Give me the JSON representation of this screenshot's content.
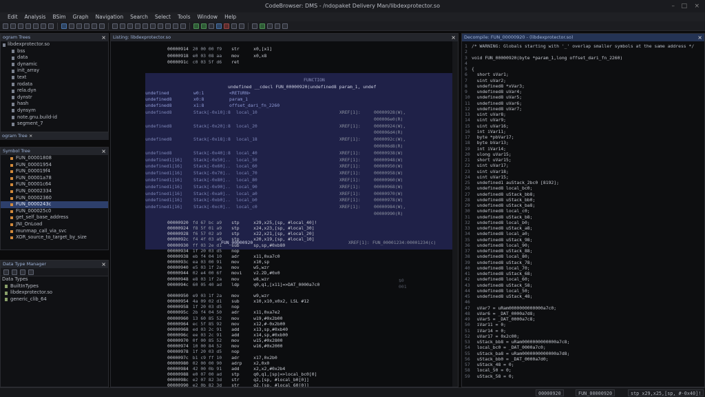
{
  "window": {
    "title": "CodeBrowser: DMS - /ndopaket Delivery Man/libdexprotector.so",
    "controls": [
      "–",
      "□",
      "×"
    ]
  },
  "menu": [
    "Edit",
    "Analysis",
    "BSim",
    "Graph",
    "Navigation",
    "Search",
    "Select",
    "Tools",
    "Window",
    "Help"
  ],
  "program_trees": {
    "header": "ogram Trees",
    "items": [
      "libdexprotector.so",
      "bss",
      "data",
      "dynamic",
      "init_array",
      "text",
      "rodata",
      "rela.dyn",
      "dynstr",
      "hash",
      "dynsym",
      "note.gnu.build-id",
      "segment_7"
    ],
    "tab": "ogram Tree"
  },
  "symbol_tree": {
    "header": "Symbol Tree",
    "items": [
      "FUN_00001808",
      "FUN_00001954",
      "FUN_000019f4",
      "FUN_00001a78",
      "FUN_00001c64",
      "FUN_00002334",
      "FUN_00002360",
      "FUN_0000243c",
      "FUN_000025c0",
      "get_self_base_address",
      "JNI_OnLoad",
      "munmap_call_via_svc",
      "XOR_source_to_target_by_size"
    ],
    "selected_index": 7
  },
  "data_type_manager": {
    "header": "Data Type Manager",
    "section": "Data Types",
    "items": [
      "BuiltInTypes",
      "libdexprotector.so",
      "generic_clib_64"
    ]
  },
  "listing": {
    "header": "Listing: libdexprotector.so",
    "top_rows": [
      {
        "addr": "00000914",
        "bytes": "20 00 00 f9",
        "mn": "str",
        "op": "x0,[x1]"
      },
      {
        "addr": "00000918",
        "bytes": "e0 03 08 aa",
        "mn": "mov",
        "op": "x0,x8"
      },
      {
        "addr": "0000091c",
        "bytes": "c0 03 5f d6",
        "mn": "ret",
        "op": ""
      }
    ],
    "func_label": "FUNCTION",
    "signature": "undefined __cdecl FUN_00000920(undefined8 param_1, undef",
    "params": [
      {
        "t": "undefined",
        "loc": "w0:1",
        "name": "<RETURN>"
      },
      {
        "t": "undefined8",
        "loc": "x0:8",
        "name": "param_1"
      },
      {
        "t": "undefined8",
        "loc": "x1:8",
        "name": "offset_dari_fn_2260"
      }
    ],
    "locals": [
      {
        "t": "undefined8",
        "loc": "Stack[-0x10]:8",
        "name": "local_10",
        "xref": "XREF[1]:",
        "ref": "00000928(W),"
      },
      {
        "t": "",
        "loc": "",
        "name": "",
        "xref": "",
        "ref": "000006e0(R)"
      },
      {
        "t": "undefined8",
        "loc": "Stack[-0x20]:8",
        "name": "local_20",
        "xref": "XREF[1]:",
        "ref": "00000924(W),"
      },
      {
        "t": "",
        "loc": "",
        "name": "",
        "xref": "",
        "ref": "000006d4(R)"
      },
      {
        "t": "undefined8",
        "loc": "Stack[-0x18]:8",
        "name": "local_18",
        "xref": "XREF[1]:",
        "ref": "0000092c(W),"
      },
      {
        "t": "",
        "loc": "",
        "name": "",
        "xref": "",
        "ref": "000006d8(R)"
      },
      {
        "t": "undefined8",
        "loc": "Stack[-0x40]:8",
        "name": "local_40",
        "xref": "XREF[1]:",
        "ref": "00000938(W)"
      },
      {
        "t": "undefined1[16]",
        "loc": "Stack[-0x50]..",
        "name": "local_50",
        "xref": "XREF[1]:",
        "ref": "00000948(W)"
      },
      {
        "t": "undefined1[16]",
        "loc": "Stack[-0x60]..",
        "name": "local_60",
        "xref": "XREF[1]:",
        "ref": "00000950(W)"
      },
      {
        "t": "undefined1[16]",
        "loc": "Stack[-0x70]..",
        "name": "local_70",
        "xref": "XREF[1]:",
        "ref": "00000958(W)"
      },
      {
        "t": "undefined1[16]",
        "loc": "Stack[-0x80]..",
        "name": "local_80",
        "xref": "XREF[1]:",
        "ref": "00000960(W)"
      },
      {
        "t": "undefined1[16]",
        "loc": "Stack[-0x90]..",
        "name": "local_90",
        "xref": "XREF[1]:",
        "ref": "00000968(W)"
      },
      {
        "t": "undefined1[16]",
        "loc": "Stack[-0xa0]..",
        "name": "local_a0",
        "xref": "XREF[1]:",
        "ref": "00000970(W)"
      },
      {
        "t": "undefined1[16]",
        "loc": "Stack[-0xb0]..",
        "name": "local_b0",
        "xref": "XREF[1]:",
        "ref": "00000978(W)"
      },
      {
        "t": "undefined1[16]",
        "loc": "Stack[-0xc0]..",
        "name": "local_c0",
        "xref": "XREF[1]:",
        "ref": "00000984(W),"
      },
      {
        "t": "",
        "loc": "",
        "name": "",
        "xref": "",
        "ref": "00000990(R)"
      }
    ],
    "fn_footer": {
      "name": "FUN_00000920",
      "xref": "XREF[1]:",
      "ref": "FUN_00001234:00001234(c)"
    },
    "code_rows": [
      {
        "addr": "00000920",
        "bytes": "fd 67 bc a9",
        "mn": "stp",
        "op": "x29,x25,[sp, #local_40]!"
      },
      {
        "addr": "00000924",
        "bytes": "f8 5f 01 a9",
        "mn": "stp",
        "op": "x24,x23,[sp, #local_30]"
      },
      {
        "addr": "00000928",
        "bytes": "f6 57 02 a9",
        "mn": "stp",
        "op": "x22,x21,[sp, #local_20]"
      },
      {
        "addr": "0000092c",
        "bytes": "f4 4f 03 a9",
        "mn": "stp",
        "op": "x20,x19,[sp, #local_10]"
      },
      {
        "addr": "00000930",
        "bytes": "ff 03 2e d1",
        "mn": "sub",
        "op": "sp,sp,#0xb80"
      },
      {
        "addr": "00000934",
        "bytes": "1f 20 03 d5",
        "mn": "nop",
        "op": ""
      },
      {
        "addr": "00000938",
        "bytes": "eb f4 04 10",
        "mn": "adr",
        "op": "x11,0xa7c0"
      },
      {
        "addr": "0000093c",
        "bytes": "ea 03 00 91",
        "mn": "mov",
        "op": "x10,sp"
      },
      {
        "addr": "00000940",
        "bytes": "e5 03 1f 2a",
        "mn": "mov",
        "op": "w5,wzr"
      },
      {
        "addr": "00000944",
        "bytes": "02 e4 00 6f",
        "mn": "movi",
        "op": "v2.2D,#0x0"
      },
      {
        "addr": "00000948",
        "bytes": "e8 03 1f 2a",
        "mn": "mov",
        "op": "w8,wzr"
      },
      {
        "addr": "0000094c",
        "bytes": "60 05 40 ad",
        "mn": "ldp",
        "op": "q0,q1,[x11]=>DAT_0000a7c0"
      },
      {
        "addr": "",
        "bytes": "",
        "mn": "",
        "op": ""
      },
      {
        "addr": "00000950",
        "bytes": "e9 03 1f 2a",
        "mn": "mov",
        "op": "w9,wzr"
      },
      {
        "addr": "00000954",
        "bytes": "4a 09 02 d1",
        "mn": "sub",
        "op": "x10,x10,x0x2, LSL #12"
      },
      {
        "addr": "00000958",
        "bytes": "1f 20 03 d5",
        "mn": "nop",
        "op": ""
      },
      {
        "addr": "0000095c",
        "bytes": "2b f4 04 50",
        "mn": "adr",
        "op": "x11,0xa7e2"
      },
      {
        "addr": "00000960",
        "bytes": "13 60 85 52",
        "mn": "mov",
        "op": "w19,#0x2b00"
      },
      {
        "addr": "00000964",
        "bytes": "ec 5f 85 92",
        "mn": "mov",
        "op": "x12,#-0x2b00"
      },
      {
        "addr": "00000968",
        "bytes": "ed 03 2c 91",
        "mn": "add",
        "op": "x13,sp,#0xb40"
      },
      {
        "addr": "0000096c",
        "bytes": "ee 03 2c 91",
        "mn": "add",
        "op": "x14,sp,#0xb00"
      },
      {
        "addr": "00000970",
        "bytes": "0f 00 85 52",
        "mn": "mov",
        "op": "w15,#0x2800"
      },
      {
        "addr": "00000974",
        "bytes": "10 00 84 52",
        "mn": "mov",
        "op": "w16,#0x2000"
      },
      {
        "addr": "00000978",
        "bytes": "1f 20 03 d5",
        "mn": "nop",
        "op": ""
      },
      {
        "addr": "0000097c",
        "bytes": "b1 c9 ff 10",
        "mn": "adr",
        "op": "x17,0x2b0"
      },
      {
        "addr": "00000980",
        "bytes": "02 00 00 90",
        "mn": "adrp",
        "op": "x2,0x0"
      },
      {
        "addr": "00000984",
        "bytes": "42 00 0b 91",
        "mn": "add",
        "op": "x2,x2,#0x2b4"
      },
      {
        "addr": "00000988",
        "bytes": "e0 07 00 ad",
        "mn": "stp",
        "op": "q0,q1,[sp]=>local_bc0[0]"
      },
      {
        "addr": "0000098c",
        "bytes": "e2 07 82 3d",
        "mn": "str",
        "op": "q2,[sp, #local_b0[0]]"
      },
      {
        "addr": "00000990",
        "bytes": "e2 0b 82 3d",
        "mn": "str",
        "op": "q2,[sp, #local_60[0]]"
      }
    ],
    "side_marks": [
      "$0",
      "001"
    ]
  },
  "decompile": {
    "header": "Decompile: FUN_00000920 - (libdexprotector.so)",
    "lines": [
      {
        "n": "1",
        "t": "/* WARNING: Globals starting with '_' overlap smaller symbols at the same address */",
        "c": "cm"
      },
      {
        "n": "2",
        "t": "",
        "c": ""
      },
      {
        "n": "3",
        "t": "void FUN_00000920(byte *param_1,long offset_dari_fn_2260)",
        "c": ""
      },
      {
        "n": "4",
        "t": "",
        "c": ""
      },
      {
        "n": "5",
        "t": "{",
        "c": ""
      },
      {
        "n": "6",
        "t": "  short sVar1;",
        "c": ""
      },
      {
        "n": "7",
        "t": "  uint uVar2;",
        "c": ""
      },
      {
        "n": "8",
        "t": "  undefined8 *xVar3;",
        "c": ""
      },
      {
        "n": "9",
        "t": "  undefined8 uVar4;",
        "c": ""
      },
      {
        "n": "10",
        "t": "  undefined8 uVar5;",
        "c": ""
      },
      {
        "n": "11",
        "t": "  undefined8 uVar6;",
        "c": ""
      },
      {
        "n": "12",
        "t": "  undefined8 uVar7;",
        "c": ""
      },
      {
        "n": "13",
        "t": "  uint uVar8;",
        "c": ""
      },
      {
        "n": "14",
        "t": "  uint uVar9;",
        "c": ""
      },
      {
        "n": "15",
        "t": "  uint uVar16;",
        "c": ""
      },
      {
        "n": "16",
        "t": "  int iVar11;",
        "c": ""
      },
      {
        "n": "17",
        "t": "  byte *pbVar17;",
        "c": ""
      },
      {
        "n": "18",
        "t": "  byte bVar13;",
        "c": ""
      },
      {
        "n": "19",
        "t": "  int iVar14;",
        "c": ""
      },
      {
        "n": "20",
        "t": "  ulong uVar15;",
        "c": ""
      },
      {
        "n": "21",
        "t": "  short uVar15;",
        "c": ""
      },
      {
        "n": "22",
        "t": "  uint uVar17;",
        "c": ""
      },
      {
        "n": "23",
        "t": "  uint uVar18;",
        "c": ""
      },
      {
        "n": "24",
        "t": "  uint uVar15;",
        "c": ""
      },
      {
        "n": "25",
        "t": "  undefined1 auStack_2bc0 [8192];",
        "c": ""
      },
      {
        "n": "26",
        "t": "  undefined8 local_bc0;",
        "c": ""
      },
      {
        "n": "27",
        "t": "  undefined8 uStack_bb8;",
        "c": ""
      },
      {
        "n": "28",
        "t": "  undefined8 uStack_bb0;",
        "c": ""
      },
      {
        "n": "29",
        "t": "  undefined8 uStack_ba8;",
        "c": ""
      },
      {
        "n": "30",
        "t": "  undefined8 local_c0;",
        "c": ""
      },
      {
        "n": "31",
        "t": "  undefined8 uStack_b8;",
        "c": ""
      },
      {
        "n": "32",
        "t": "  undefined8 local_b0;",
        "c": ""
      },
      {
        "n": "33",
        "t": "  undefined8 uStack_a8;",
        "c": ""
      },
      {
        "n": "34",
        "t": "  undefined8 local_a0;",
        "c": ""
      },
      {
        "n": "35",
        "t": "  undefined8 uStack_98;",
        "c": ""
      },
      {
        "n": "36",
        "t": "  undefined8 local_90;",
        "c": ""
      },
      {
        "n": "37",
        "t": "  undefined8 uStack_88;",
        "c": ""
      },
      {
        "n": "38",
        "t": "  undefined8 local_80;",
        "c": ""
      },
      {
        "n": "39",
        "t": "  undefined8 uStack_78;",
        "c": ""
      },
      {
        "n": "40",
        "t": "  undefined8 local_70;",
        "c": ""
      },
      {
        "n": "41",
        "t": "  undefined8 uStack_68;",
        "c": ""
      },
      {
        "n": "42",
        "t": "  undefined8 local_60;",
        "c": ""
      },
      {
        "n": "43",
        "t": "  undefined8 uStack_58;",
        "c": ""
      },
      {
        "n": "44",
        "t": "  undefined8 local_50;",
        "c": ""
      },
      {
        "n": "45",
        "t": "  undefined8 uStack_48;",
        "c": ""
      },
      {
        "n": "46",
        "t": "",
        "c": ""
      },
      {
        "n": "47",
        "t": "  uVar7 = uRam0000000000000a7c0;",
        "c": "grn"
      },
      {
        "n": "48",
        "t": "  uVar6 = _DAT_0000a7d8;",
        "c": ""
      },
      {
        "n": "49",
        "t": "  uVar5 = _DAT_0000a7c8;",
        "c": ""
      },
      {
        "n": "50",
        "t": "  iVar11 = 0;",
        "c": ""
      },
      {
        "n": "51",
        "t": "  iVar14 = 0;",
        "c": ""
      },
      {
        "n": "52",
        "t": "  uVar17 = 0x2c00;",
        "c": ""
      },
      {
        "n": "53",
        "t": "  uStack_bb8 = uRam0000000000000a7c8;",
        "c": "grn"
      },
      {
        "n": "54",
        "t": "  local_bc0 = _DAT_0000a7c0;",
        "c": ""
      },
      {
        "n": "55",
        "t": "  uStack_ba8 = uRam0000000000000a7d8;",
        "c": "grn"
      },
      {
        "n": "56",
        "t": "  uStack_bb0 = _DAT_0000a7d0;",
        "c": ""
      },
      {
        "n": "57",
        "t": "  uStack_48 = 0;",
        "c": ""
      },
      {
        "n": "58",
        "t": "  local_50 = 0;",
        "c": ""
      },
      {
        "n": "59",
        "t": "  uStack_58 = 0;",
        "c": ""
      }
    ]
  },
  "status": {
    "addr": "00000920",
    "func": "FUN_00000920",
    "instr": "stp x29,x25,[sp, #-0x40]!"
  }
}
